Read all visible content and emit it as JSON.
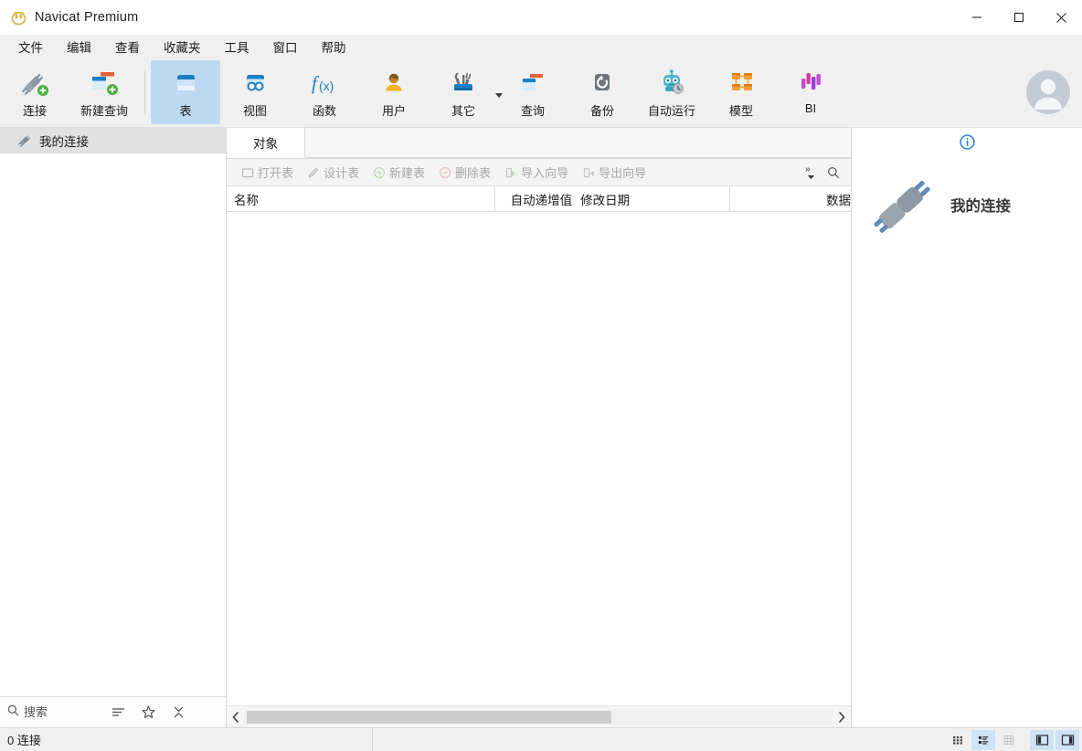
{
  "window": {
    "title": "Navicat Premium",
    "app_icon": "navicat-logo-icon",
    "controls": {
      "minimize": "minimize-icon",
      "maximize": "maximize-icon",
      "close": "close-icon"
    }
  },
  "menubar": {
    "items": [
      {
        "label": "文件"
      },
      {
        "label": "编辑"
      },
      {
        "label": "查看"
      },
      {
        "label": "收藏夹"
      },
      {
        "label": "工具"
      },
      {
        "label": "窗口"
      },
      {
        "label": "帮助"
      }
    ]
  },
  "toolbar": {
    "items": [
      {
        "label": "连接",
        "icon": "connection-plus-icon",
        "active": false,
        "caret": false
      },
      {
        "label": "新建查询",
        "icon": "new-query-icon",
        "active": false,
        "caret": false
      },
      {
        "label": "表",
        "icon": "table-icon",
        "active": true,
        "caret": false
      },
      {
        "label": "视图",
        "icon": "view-icon",
        "active": false,
        "caret": false
      },
      {
        "label": "函数",
        "icon": "function-icon",
        "active": false,
        "caret": false
      },
      {
        "label": "用户",
        "icon": "user-icon",
        "active": false,
        "caret": false
      },
      {
        "label": "其它",
        "icon": "other-tools-icon",
        "active": false,
        "caret": true
      },
      {
        "label": "查询",
        "icon": "query-icon",
        "active": false,
        "caret": false
      },
      {
        "label": "备份",
        "icon": "backup-icon",
        "active": false,
        "caret": false
      },
      {
        "label": "自动运行",
        "icon": "automation-robot-icon",
        "active": false,
        "caret": false
      },
      {
        "label": "模型",
        "icon": "model-icon",
        "active": false,
        "caret": false
      },
      {
        "label": "BI",
        "icon": "bi-chart-icon",
        "active": false,
        "caret": false
      }
    ],
    "avatar": "user-avatar-icon"
  },
  "sidebar": {
    "connections": [
      {
        "label": "我的连接",
        "icon": "connection-plug-icon",
        "selected": true
      }
    ],
    "search": {
      "placeholder": "搜索",
      "icon": "search-icon"
    },
    "footer_icons": [
      {
        "name": "filter-icon"
      },
      {
        "name": "favorite-star-icon"
      },
      {
        "name": "collapse-all-icon"
      }
    ]
  },
  "center": {
    "tabs": [
      {
        "label": "对象",
        "active": true
      }
    ],
    "object_toolbar": {
      "buttons": [
        {
          "label": "打开表",
          "icon": "open-table-icon"
        },
        {
          "label": "设计表",
          "icon": "design-table-icon"
        },
        {
          "label": "新建表",
          "icon": "new-table-icon"
        },
        {
          "label": "删除表",
          "icon": "delete-table-icon"
        },
        {
          "label": "导入向导",
          "icon": "import-wizard-icon"
        },
        {
          "label": "导出向导",
          "icon": "export-wizard-icon"
        }
      ],
      "overflow_icon": "chevron-double-right-icon",
      "search_icon": "search-icon"
    },
    "columns": [
      {
        "label": "名称"
      },
      {
        "label": "自动递增值"
      },
      {
        "label": "修改日期"
      },
      {
        "label": "数据"
      }
    ],
    "rows": [],
    "hscroll": {
      "left_arrow": "chevron-left-icon",
      "right_arrow": "chevron-right-icon"
    }
  },
  "info_panel": {
    "info_icon": "info-circle-icon",
    "illustration": "connection-plug-illustration",
    "title": "我的连接"
  },
  "statusbar": {
    "text": "0 连接",
    "view_buttons": [
      {
        "name": "grid-view-icon",
        "active": false
      },
      {
        "name": "list-view-icon",
        "active": true
      },
      {
        "name": "detail-view-icon",
        "active": false
      },
      {
        "name": "left-panel-toggle-icon",
        "active": true
      },
      {
        "name": "right-panel-toggle-icon",
        "active": true
      }
    ]
  },
  "colors": {
    "accent": "#2f7fd1",
    "toolbar_bg": "#f0f0f0",
    "active_tool": "#bdd9f2",
    "selected_row": "#e1e1e1",
    "statusbar_active": "#cfe3f7"
  }
}
